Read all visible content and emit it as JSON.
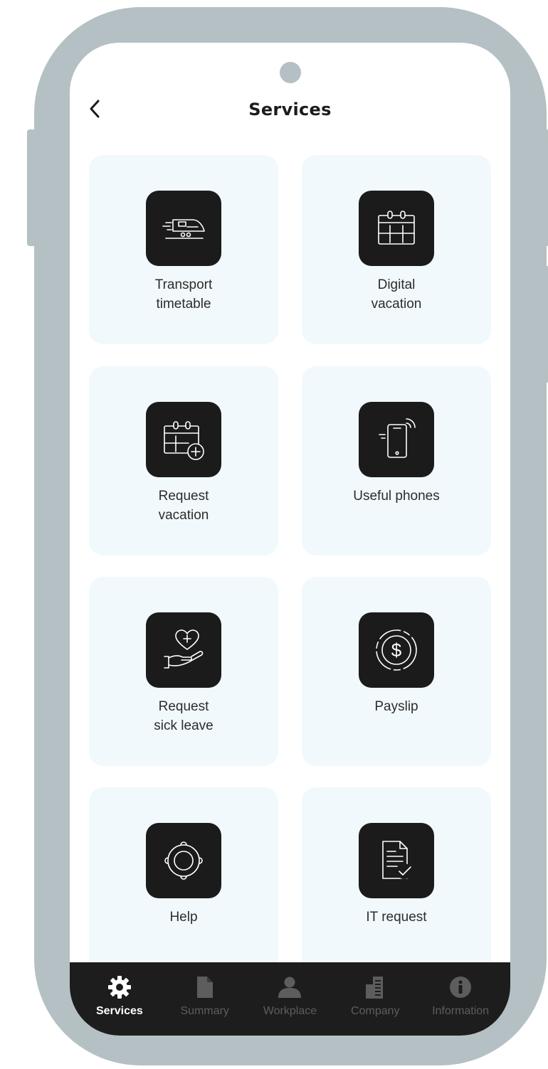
{
  "header": {
    "title": "Services",
    "back_icon": "chevron-left-icon"
  },
  "services": [
    {
      "label": "Transport\ntimetable",
      "icon": "train-icon"
    },
    {
      "label": "Digital\nvacation",
      "icon": "calendar-icon"
    },
    {
      "label": "Request\nvacation",
      "icon": "calendar-add-icon"
    },
    {
      "label": "Useful phones",
      "icon": "mobile-phone-icon"
    },
    {
      "label": "Request\nsick leave",
      "icon": "heart-hand-icon"
    },
    {
      "label": "Payslip",
      "icon": "dollar-coin-icon"
    },
    {
      "label": "Help",
      "icon": "lifebuoy-icon"
    },
    {
      "label": "IT request",
      "icon": "document-check-icon"
    }
  ],
  "tab_bar": {
    "active": "Services",
    "tabs": [
      {
        "label": "Services",
        "icon": "gear-icon"
      },
      {
        "label": "Summary",
        "icon": "document-icon"
      },
      {
        "label": "Workplace",
        "icon": "user-icon"
      },
      {
        "label": "Company",
        "icon": "building-icon"
      },
      {
        "label": "Information",
        "icon": "info-icon"
      }
    ]
  },
  "colors": {
    "frame": "#b5c0c4",
    "tile_bg": "#f1f9fd",
    "icon_bg": "#1b1b1b",
    "tab_bar_bg": "#1d1d1d",
    "tab_active": "#ffffff",
    "tab_inactive": "#5d5d5d"
  }
}
